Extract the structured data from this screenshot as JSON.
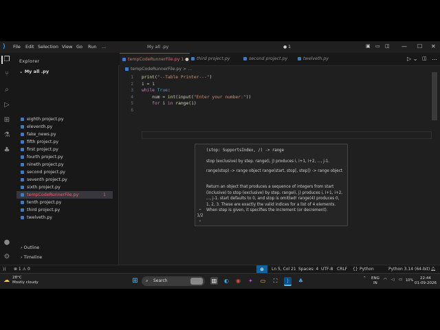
{
  "menu": {
    "items": [
      "File",
      "Edit",
      "Selection",
      "View",
      "Go",
      "Run",
      "..."
    ]
  },
  "window_title": "My all .py",
  "title_controls": {
    "badge": "1",
    "minimize": "—",
    "maximize": "☐",
    "close": "✕"
  },
  "explorer": {
    "title": "Explorer",
    "folder": "My all .py",
    "files": [
      "eighth project.py",
      "eleventh.py",
      "fake_news.py",
      "fifth project.py",
      "first project.py",
      "fourth project.py",
      "nineth project.py",
      "second project.py",
      "seventh project.py",
      "sixth project.py",
      "tempCodeRunnerFile.py",
      "tenth project.py",
      "third project.py",
      "twelveth.py"
    ],
    "active_file_badge": "1",
    "outline": "Outline",
    "timeline": "Timeline"
  },
  "tabs": [
    {
      "label": "tempCodeRunnerFile.py",
      "suffix": "1"
    },
    {
      "label": "third project.py"
    },
    {
      "label": "second project.py"
    },
    {
      "label": "twelveth.py"
    }
  ],
  "breadcrumb": "tempCodeRunnerFile.py > ...",
  "code": {
    "line_numbers": [
      "1",
      "2",
      "3",
      "4",
      "5",
      "6"
    ],
    "lines": [
      "print(\"--Table Printer---\")",
      "i = 1",
      "while True:",
      "    num = int(input(\"Enter your number:\"))",
      "    for i in range(1)",
      ""
    ]
  },
  "hover": {
    "signature": "(stop: SupportsIndex, /) -> range",
    "line1": "stop (exclusive) by step. range(i, j) produces i, i+1, i+2, ..., j-1.",
    "line2": "range(stop) -> range object range(start, stop[, step]) -> range object",
    "line3": "Return an object that produces a sequence of integers from start (inclusive) to stop (exclusive) by step. range(i, j) produces i, i+1, i+2, ..., j-1. start defaults to 0, and stop is omitted! range(4) produces 0, 1, 2, 3. These are exactly the valid indices for a list of 4 elements. When step is given, it specifies the increment (or decrement).",
    "pager": "1/2"
  },
  "status": {
    "errors": "⊗ 1 ⚠ 0",
    "position": "Ln 5, Col 21",
    "spaces": "Spaces: 4",
    "encoding": "UTF-8",
    "eol": "CRLF",
    "language": "Python",
    "interpreter": "Python 3.14 (64-bit)"
  },
  "taskbar": {
    "weather_temp": "28°C",
    "weather_desc": "Mostly cloudy",
    "search": "Search",
    "lang": "ENG",
    "region": "IN",
    "battery": "10%",
    "time": "22:44",
    "date": "01-09-2026"
  },
  "colors": {
    "accent": "#0078d4",
    "error": "#e06c75",
    "file_icon": "#3e7cc1"
  }
}
